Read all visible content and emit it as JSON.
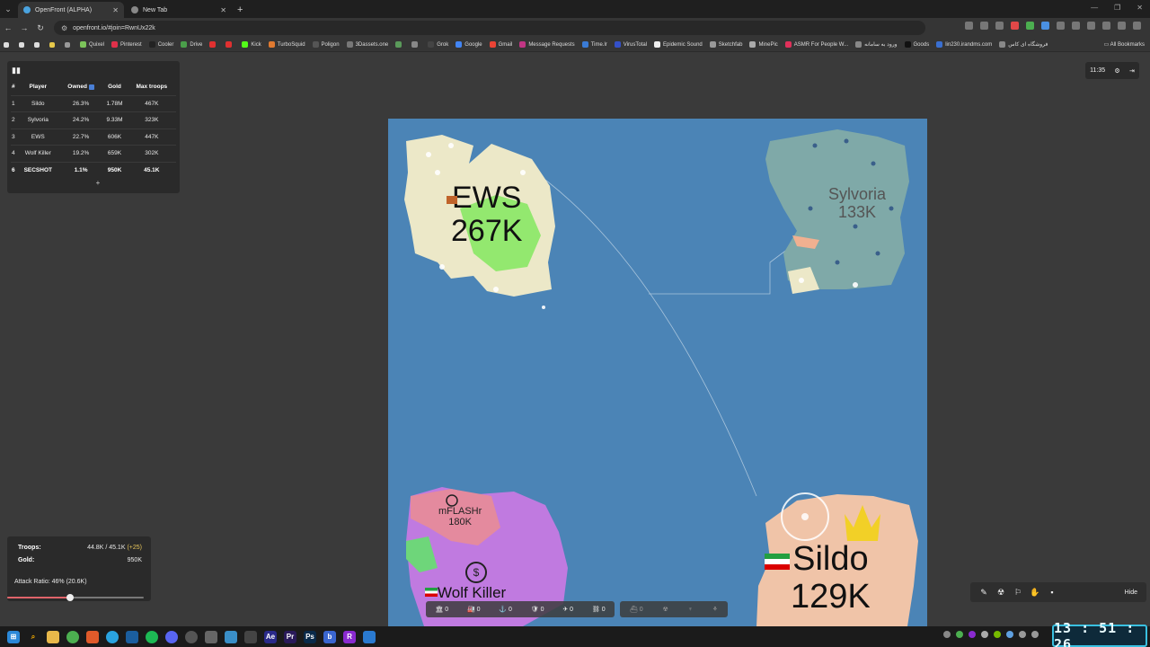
{
  "browser": {
    "tabs": [
      {
        "title": "OpenFront (ALPHA)",
        "active": true
      },
      {
        "title": "New Tab",
        "active": false
      }
    ],
    "new_tab_symbol": "+",
    "url": "openfront.io/#join=RwnUx22k",
    "bookmarks": [
      "Quixel",
      "Pinterest",
      "Cooler",
      "Drive",
      "Kick",
      "TurboSquid",
      "Poligon",
      "3Dassets.one",
      "Grok",
      "Google",
      "Gmail",
      "Message Requests",
      "Time.lr",
      "VirusTotal",
      "Epidemic Sound",
      "Sketchfab",
      "MinePic",
      "ASMR For People W...",
      "ورود به سامانه",
      "Goods",
      "lin230.irandms.com",
      "فروشگاه ای کاس"
    ],
    "all_bookmarks": "All Bookmarks"
  },
  "leaderboard": {
    "headers": [
      "#",
      "Player",
      "Owned",
      "Gold",
      "Max troops"
    ],
    "rows": [
      {
        "rank": "1",
        "player": "Sildo",
        "owned": "26.3%",
        "gold": "1.78M",
        "troops": "467K"
      },
      {
        "rank": "2",
        "player": "Sylvoria",
        "owned": "24.2%",
        "gold": "9.33M",
        "troops": "323K"
      },
      {
        "rank": "3",
        "player": "EWS",
        "owned": "22.7%",
        "gold": "606K",
        "troops": "447K"
      },
      {
        "rank": "4",
        "player": "Wolf Killer",
        "owned": "19.2%",
        "gold": "659K",
        "troops": "302K"
      },
      {
        "rank": "6",
        "player": "SECSHOT",
        "owned": "1.1%",
        "gold": "950K",
        "troops": "45.1K"
      }
    ],
    "more_button": "+"
  },
  "top_right": {
    "time": "11:35"
  },
  "map": {
    "labels": [
      {
        "name": "EWS",
        "troops": "267K"
      },
      {
        "name": "Sylvoria",
        "troops": "133K"
      },
      {
        "name": "Sildo",
        "troops": "129K"
      },
      {
        "name": "Wolf Killer",
        "troops": ""
      },
      {
        "name": "mFLASHr",
        "troops": "180K"
      }
    ]
  },
  "stats": {
    "troops_label": "Troops:",
    "troops_value": "44.8K / 45.1K",
    "troops_rate": "(+25)",
    "gold_label": "Gold:",
    "gold_value": "950K",
    "attack_ratio_label": "Attack Ratio: 46% (20.6K)",
    "attack_ratio": 0.46
  },
  "build_bar": {
    "counts": [
      "0",
      "0",
      "0",
      "0",
      "0",
      "0"
    ],
    "counts2": [
      "0"
    ]
  },
  "emoji_bar": {
    "hide_label": "Hide"
  },
  "taskbar": {
    "clock": "13 : 51 : 26"
  },
  "colors": {
    "ocean": "#4b84b6",
    "ews": "#ece8c8",
    "sylvoria": "#7fa9a8",
    "sildo": "#f0c4a8",
    "wolf": "#c07ae0"
  }
}
